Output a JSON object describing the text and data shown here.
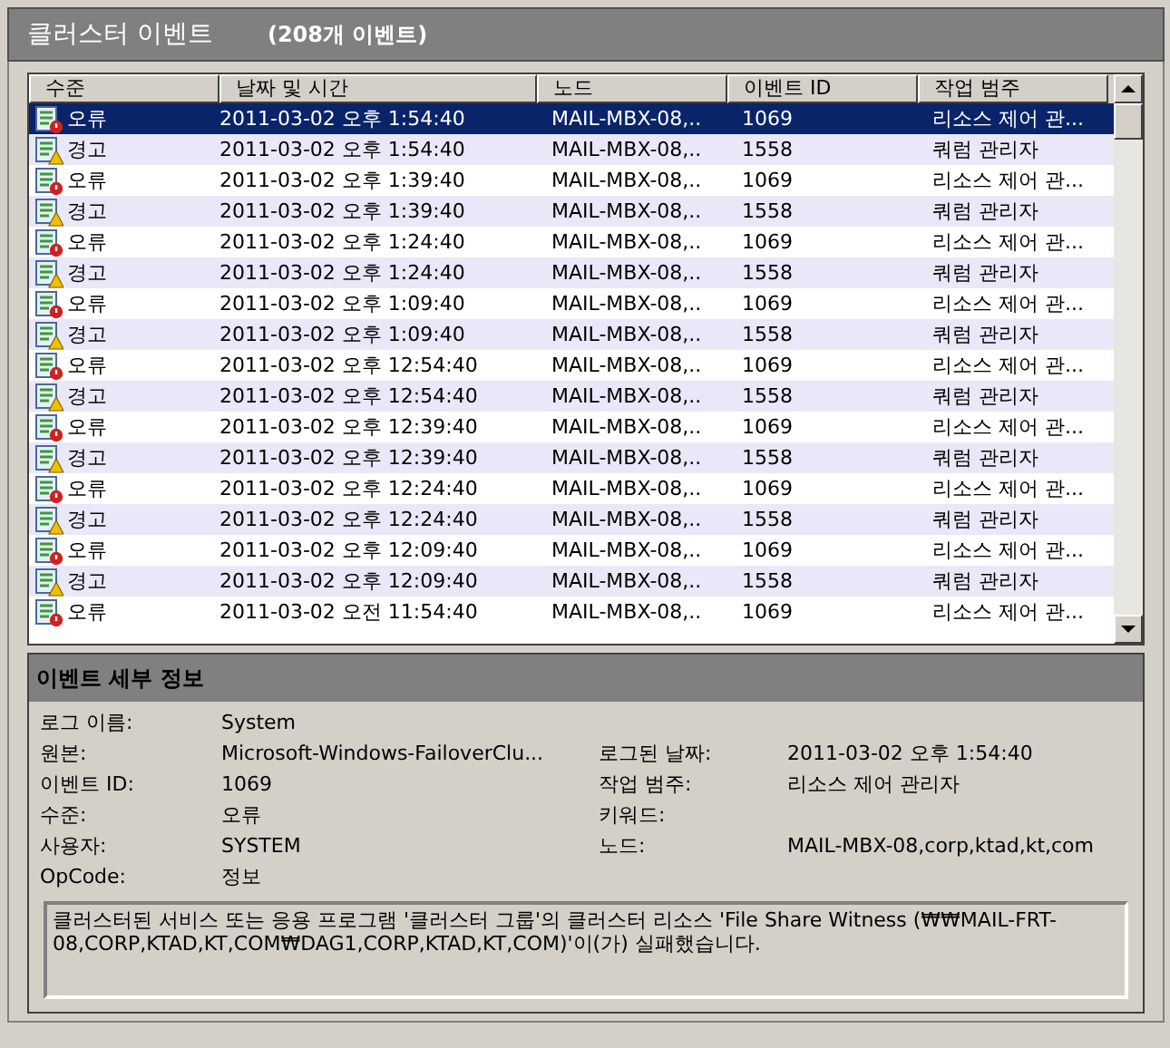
{
  "title": "클러스터 이벤트",
  "count": "(208개 이벤트)",
  "table": {
    "columns": [
      "수준",
      "날짜 및 시간",
      "노드",
      "이벤트 ID",
      "작업 범주"
    ],
    "rows": [
      {
        "kind": "error",
        "level": "오류",
        "datetime": "2011-03-02 오후 1:54:40",
        "node": "MAIL-MBX-08,..",
        "event_id": "1069",
        "category": "리소스 제어 관...",
        "selected": true
      },
      {
        "kind": "warning",
        "level": "경고",
        "datetime": "2011-03-02 오후 1:54:40",
        "node": "MAIL-MBX-08,..",
        "event_id": "1558",
        "category": "쿼럼 관리자",
        "selected": false
      },
      {
        "kind": "error",
        "level": "오류",
        "datetime": "2011-03-02 오후 1:39:40",
        "node": "MAIL-MBX-08,..",
        "event_id": "1069",
        "category": "리소스 제어 관...",
        "selected": false
      },
      {
        "kind": "warning",
        "level": "경고",
        "datetime": "2011-03-02 오후 1:39:40",
        "node": "MAIL-MBX-08,..",
        "event_id": "1558",
        "category": "쿼럼 관리자",
        "selected": false
      },
      {
        "kind": "error",
        "level": "오류",
        "datetime": "2011-03-02 오후 1:24:40",
        "node": "MAIL-MBX-08,..",
        "event_id": "1069",
        "category": "리소스 제어 관...",
        "selected": false
      },
      {
        "kind": "warning",
        "level": "경고",
        "datetime": "2011-03-02 오후 1:24:40",
        "node": "MAIL-MBX-08,..",
        "event_id": "1558",
        "category": "쿼럼 관리자",
        "selected": false
      },
      {
        "kind": "error",
        "level": "오류",
        "datetime": "2011-03-02 오후 1:09:40",
        "node": "MAIL-MBX-08,..",
        "event_id": "1069",
        "category": "리소스 제어 관...",
        "selected": false
      },
      {
        "kind": "warning",
        "level": "경고",
        "datetime": "2011-03-02 오후 1:09:40",
        "node": "MAIL-MBX-08,..",
        "event_id": "1558",
        "category": "쿼럼 관리자",
        "selected": false
      },
      {
        "kind": "error",
        "level": "오류",
        "datetime": "2011-03-02 오후 12:54:40",
        "node": "MAIL-MBX-08,..",
        "event_id": "1069",
        "category": "리소스 제어 관...",
        "selected": false
      },
      {
        "kind": "warning",
        "level": "경고",
        "datetime": "2011-03-02 오후 12:54:40",
        "node": "MAIL-MBX-08,..",
        "event_id": "1558",
        "category": "쿼럼 관리자",
        "selected": false
      },
      {
        "kind": "error",
        "level": "오류",
        "datetime": "2011-03-02 오후 12:39:40",
        "node": "MAIL-MBX-08,..",
        "event_id": "1069",
        "category": "리소스 제어 관...",
        "selected": false
      },
      {
        "kind": "warning",
        "level": "경고",
        "datetime": "2011-03-02 오후 12:39:40",
        "node": "MAIL-MBX-08,..",
        "event_id": "1558",
        "category": "쿼럼 관리자",
        "selected": false
      },
      {
        "kind": "error",
        "level": "오류",
        "datetime": "2011-03-02 오후 12:24:40",
        "node": "MAIL-MBX-08,..",
        "event_id": "1069",
        "category": "리소스 제어 관...",
        "selected": false
      },
      {
        "kind": "warning",
        "level": "경고",
        "datetime": "2011-03-02 오후 12:24:40",
        "node": "MAIL-MBX-08,..",
        "event_id": "1558",
        "category": "쿼럼 관리자",
        "selected": false
      },
      {
        "kind": "error",
        "level": "오류",
        "datetime": "2011-03-02 오후 12:09:40",
        "node": "MAIL-MBX-08,..",
        "event_id": "1069",
        "category": "리소스 제어 관...",
        "selected": false
      },
      {
        "kind": "warning",
        "level": "경고",
        "datetime": "2011-03-02 오후 12:09:40",
        "node": "MAIL-MBX-08,..",
        "event_id": "1558",
        "category": "쿼럼 관리자",
        "selected": false
      },
      {
        "kind": "error",
        "level": "오류",
        "datetime": "2011-03-02 오전 11:54:40",
        "node": "MAIL-MBX-08,..",
        "event_id": "1069",
        "category": "리소스 제어 관...",
        "selected": false
      }
    ]
  },
  "details": {
    "title": "이벤트 세부 정보",
    "fields": [
      {
        "label": "로그 이름:",
        "value": "System"
      },
      {
        "label": "원본:",
        "value": "Microsoft-Windows-FailoverClu...",
        "label_2": "로그된 날짜:",
        "value_2": "2011-03-02 오후 1:54:40"
      },
      {
        "label": "이벤트 ID:",
        "value": "1069",
        "label_2": "작업 범주:",
        "value_2": "리소스 제어 관리자"
      },
      {
        "label": "수준:",
        "value": "오류",
        "label_2": "키워드:"
      },
      {
        "label": "사용자:",
        "value": "SYSTEM",
        "label_2": "노드:",
        "value_2": "MAIL-MBX-08,corp,ktad,kt,com"
      },
      {
        "label": "OpCode:",
        "value": "정보"
      }
    ],
    "message": "클러스터된 서비스 또는 응용 프로그램 '클러스터 그룹'의 클러스터 리소스 'File Share Witness (₩₩MAIL-FRT-08,CORP,KTAD,KT,COM₩DAG1,CORP,KTAD,KT,COM)'이(가) 실패했습니다."
  }
}
